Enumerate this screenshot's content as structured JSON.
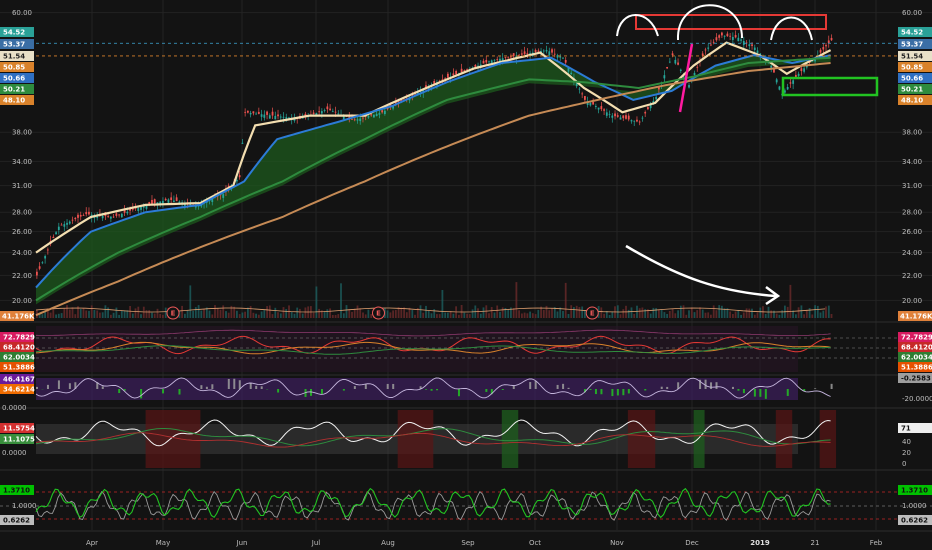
{
  "chart_data": {
    "type": "line",
    "x_ticks": [
      "Apr",
      "May",
      "Jun",
      "Jul",
      "Aug",
      "Sep",
      "Oct",
      "Nov",
      "Dec",
      "2019",
      "21",
      "Feb"
    ],
    "price_axis": {
      "scale": "log",
      "ticks": [
        "60.00",
        "38.00",
        "34.00",
        "31.00",
        "28.00",
        "26.00",
        "24.00",
        "22.00",
        "20.00"
      ],
      "ylim": [
        18.7,
        62
      ]
    },
    "price_series": [
      {
        "x": 0,
        "y": 22.0
      },
      {
        "x": 8,
        "y": 26.5
      },
      {
        "x": 18,
        "y": 27.8
      },
      {
        "x": 28,
        "y": 27.5
      },
      {
        "x": 38,
        "y": 28.6
      },
      {
        "x": 48,
        "y": 29.4
      },
      {
        "x": 58,
        "y": 28.8
      },
      {
        "x": 68,
        "y": 30.0
      },
      {
        "x": 74,
        "y": 32.0
      },
      {
        "x": 76,
        "y": 41.0
      },
      {
        "x": 86,
        "y": 40.5
      },
      {
        "x": 96,
        "y": 40.0
      },
      {
        "x": 106,
        "y": 41.5
      },
      {
        "x": 116,
        "y": 39.8
      },
      {
        "x": 126,
        "y": 41.0
      },
      {
        "x": 136,
        "y": 43.5
      },
      {
        "x": 146,
        "y": 46.0
      },
      {
        "x": 156,
        "y": 48.0
      },
      {
        "x": 166,
        "y": 50.0
      },
      {
        "x": 176,
        "y": 51.0
      },
      {
        "x": 186,
        "y": 52.0
      },
      {
        "x": 192,
        "y": 50.5
      },
      {
        "x": 200,
        "y": 43.0
      },
      {
        "x": 210,
        "y": 40.5
      },
      {
        "x": 220,
        "y": 39.5
      },
      {
        "x": 226,
        "y": 43.5
      },
      {
        "x": 232,
        "y": 51.0
      },
      {
        "x": 238,
        "y": 45.5
      },
      {
        "x": 244,
        "y": 52.0
      },
      {
        "x": 250,
        "y": 55.0
      },
      {
        "x": 256,
        "y": 54.5
      },
      {
        "x": 262,
        "y": 52.5
      },
      {
        "x": 268,
        "y": 49.0
      },
      {
        "x": 272,
        "y": 44.0
      },
      {
        "x": 278,
        "y": 47.5
      },
      {
        "x": 286,
        "y": 51.5
      },
      {
        "x": 290,
        "y": 54.0
      }
    ],
    "ma_series": [
      {
        "name": "",
        "color": "#f3deb0",
        "values": [
          [
            0,
            24.0
          ],
          [
            20,
            27.5
          ],
          [
            40,
            28.8
          ],
          [
            60,
            29.0
          ],
          [
            72,
            31.0
          ],
          [
            80,
            39.0
          ],
          [
            100,
            40.5
          ],
          [
            120,
            40.5
          ],
          [
            140,
            44.5
          ],
          [
            160,
            48.5
          ],
          [
            184,
            51.5
          ],
          [
            200,
            45.0
          ],
          [
            214,
            41.0
          ],
          [
            226,
            42.5
          ],
          [
            240,
            49.0
          ],
          [
            252,
            53.5
          ],
          [
            264,
            51.0
          ],
          [
            274,
            47.5
          ],
          [
            290,
            52.0
          ]
        ]
      },
      {
        "name": "",
        "color": "#2c7bd6",
        "values": [
          [
            0,
            21.0
          ],
          [
            20,
            26.0
          ],
          [
            40,
            28.0
          ],
          [
            60,
            28.8
          ],
          [
            76,
            31.5
          ],
          [
            88,
            37.0
          ],
          [
            110,
            39.5
          ],
          [
            130,
            42.0
          ],
          [
            150,
            46.0
          ],
          [
            170,
            49.5
          ],
          [
            188,
            50.5
          ],
          [
            204,
            46.0
          ],
          [
            218,
            43.0
          ],
          [
            232,
            44.5
          ],
          [
            248,
            49.0
          ],
          [
            262,
            51.0
          ],
          [
            276,
            49.5
          ],
          [
            290,
            51.0
          ]
        ]
      },
      {
        "name": "",
        "color": "#2e8b3e",
        "values": [
          [
            0,
            20.0
          ],
          [
            30,
            24.0
          ],
          [
            60,
            27.5
          ],
          [
            90,
            31.5
          ],
          [
            120,
            37.0
          ],
          [
            150,
            43.0
          ],
          [
            180,
            46.5
          ],
          [
            200,
            46.0
          ],
          [
            220,
            45.0
          ],
          [
            240,
            47.0
          ],
          [
            260,
            49.5
          ],
          [
            290,
            50.5
          ]
        ]
      },
      {
        "name": "",
        "color": "#c58a55",
        "values": [
          [
            0,
            18.9
          ],
          [
            30,
            21.5
          ],
          [
            60,
            24.5
          ],
          [
            90,
            27.5
          ],
          [
            120,
            31.5
          ],
          [
            150,
            36.0
          ],
          [
            180,
            40.5
          ],
          [
            200,
            42.5
          ],
          [
            230,
            45.5
          ],
          [
            260,
            48.0
          ],
          [
            290,
            49.5
          ]
        ]
      }
    ],
    "price_badges": [
      {
        "text": "54.52",
        "color": "#2aa198",
        "y": 54.52
      },
      {
        "text": "53.37",
        "color": "#3a6ea5",
        "y": 53.37
      },
      {
        "text": "51.54",
        "color": "#e8e0c8",
        "y": 51.54
      },
      {
        "text": "50.85",
        "color": "#d9822b",
        "y": 50.85
      },
      {
        "text": "50.66",
        "color": "#2f6fc2",
        "y": 50.66
      },
      {
        "text": "50.21",
        "color": "#2e8b3e",
        "y": 50.21
      },
      {
        "text": "48.10",
        "color": "#d9822b",
        "y": 48.1
      }
    ],
    "volume_badge": "41.176K",
    "earnings_marker": "E",
    "earnings_x": [
      50,
      125,
      203
    ],
    "panel_rsi": {
      "badges": [
        {
          "text": "72.7829",
          "color": "#d81b60"
        },
        {
          "text": "68.4120",
          "color": "#c62828"
        },
        {
          "text": "62.0034",
          "color": "#2e7d32"
        },
        {
          "text": "51.3886",
          "color": "#e65100"
        }
      ]
    },
    "panel_osc": {
      "badges_left": [
        {
          "text": "46.4167",
          "color": "#6a1b9a"
        },
        {
          "text": "34.6214",
          "color": "#ef6c00"
        }
      ],
      "ticks_left": [
        "0.0000"
      ],
      "badges_right": [
        {
          "text": "-0.2583",
          "color": "#9e9e9e"
        }
      ],
      "ticks_right": [
        "-20.0000"
      ]
    },
    "panel_stoch": {
      "badges_left": [
        {
          "text": "11.5754",
          "color": "#d32f2f"
        },
        {
          "text": "11.1075",
          "color": "#388e3c"
        }
      ],
      "ticks_left": [
        "0.0000"
      ],
      "badges_right": [
        {
          "text": "71",
          "color": "#eeeeee"
        }
      ],
      "ticks_right": [
        "40",
        "20",
        "0"
      ]
    },
    "panel_ratio": {
      "badges_left": [
        {
          "text": "1.3710",
          "color": "#00c000"
        },
        {
          "text": "0.6262",
          "color": "#bdbdbd"
        }
      ],
      "ticks_left": [
        "1.0000"
      ],
      "badges_right": [
        {
          "text": "1.3710",
          "color": "#00c000"
        },
        {
          "text": "0.6262",
          "color": "#bdbdbd"
        }
      ],
      "ticks_right": [
        "1.0000"
      ]
    }
  }
}
